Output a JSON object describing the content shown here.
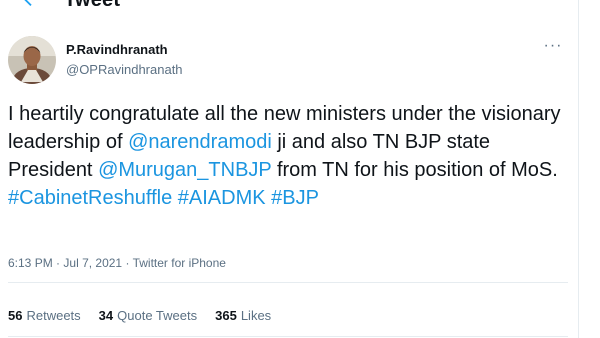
{
  "header": {
    "title": "Tweet",
    "back_icon": "arrow-left-icon"
  },
  "author": {
    "name": "P.Ravindhranath",
    "handle": "@OPRavindhranath",
    "avatar_icon": "profile-avatar"
  },
  "more_icon": "more-horizontal-icon",
  "tweet": {
    "text_1": "I heartily congratulate all the new ministers under the visionary leadership of ",
    "mention_1": "@narendramodi",
    "text_2": " ji and also TN BJP state President ",
    "mention_2": "@Murugan_TNBJP",
    "text_3": " from TN for his position of MoS.",
    "hashtag_1": "#CabinetReshuffle",
    "hashtag_2": "#AIADMK",
    "hashtag_3": "#BJP"
  },
  "meta": {
    "time": "6:13 PM",
    "separator": "·",
    "date": "Jul 7, 2021",
    "source": "Twitter for iPhone"
  },
  "stats": {
    "retweets_count": "56",
    "retweets_label": "Retweets",
    "quotes_count": "34",
    "quotes_label": "Quote Tweets",
    "likes_count": "365",
    "likes_label": "Likes"
  },
  "colors": {
    "link": "#1b95e0",
    "text": "#0f1419",
    "secondary": "#5b7083",
    "border": "#e6ecf0"
  }
}
